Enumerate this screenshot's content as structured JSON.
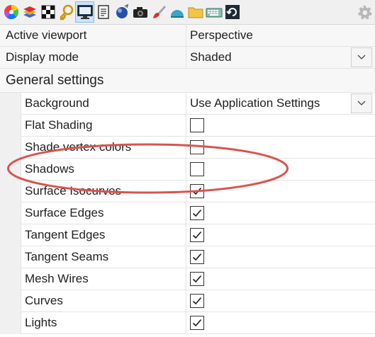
{
  "toolbar": {
    "icons": [
      "color-wheel-icon",
      "layers-icon",
      "checker-icon",
      "key-icon",
      "display-icon",
      "notes-icon",
      "render-sphere-icon",
      "camera-icon",
      "brush-icon",
      "environment-icon",
      "folder-icon",
      "keyboard-icon",
      "restore-icon"
    ],
    "active_index": 4,
    "settings_icon": "gear-icon"
  },
  "top_rows": [
    {
      "label": "Active viewport",
      "value": "Perspective"
    },
    {
      "label": "Display mode",
      "value": "Shaded"
    }
  ],
  "section": {
    "title": "General settings"
  },
  "background_row": {
    "label": "Background",
    "value": "Use Application Settings"
  },
  "options": [
    {
      "label": "Flat Shading",
      "checked": false
    },
    {
      "label": "Shade vertex colors",
      "checked": false
    },
    {
      "label": "Shadows",
      "checked": false
    },
    {
      "label": "Surface Isocurves",
      "checked": true
    },
    {
      "label": "Surface Edges",
      "checked": true
    },
    {
      "label": "Tangent Edges",
      "checked": true
    },
    {
      "label": "Tangent Seams",
      "checked": true
    },
    {
      "label": "Mesh Wires",
      "checked": true
    },
    {
      "label": "Curves",
      "checked": true
    },
    {
      "label": "Lights",
      "checked": true
    }
  ],
  "colors": {
    "callout": "#d9534f",
    "checkmark": "#1a1a1a",
    "active_tab": "#cfe3f7"
  }
}
